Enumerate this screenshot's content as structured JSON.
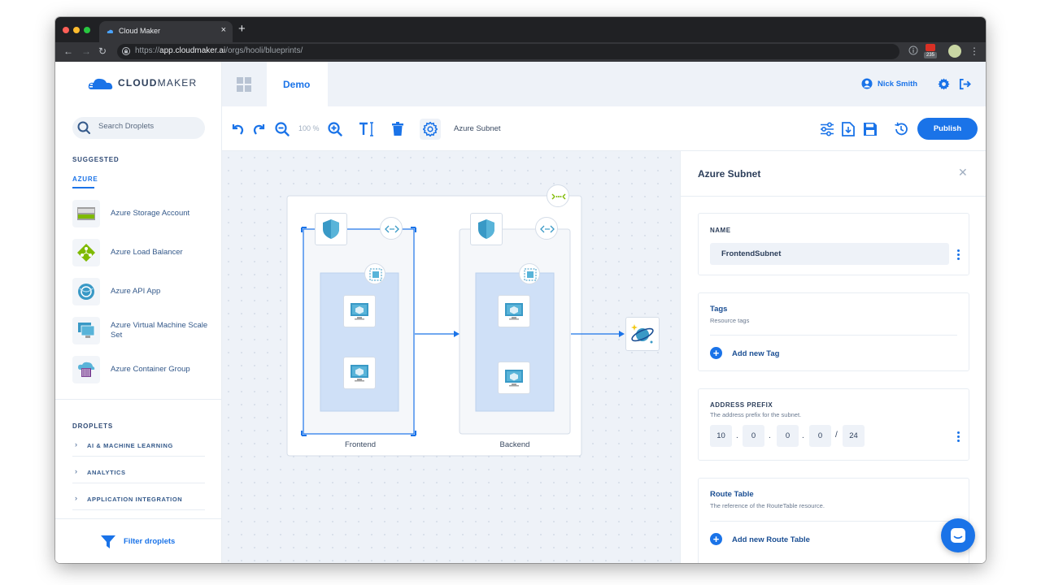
{
  "browser": {
    "tab_title": "Cloud Maker",
    "tab_close": "×",
    "new_tab": "+",
    "url_scheme": "https://",
    "url_host": "app.cloudmaker.ai",
    "url_path": "/orgs/hooli/blueprints/",
    "nav_back": "←",
    "nav_forward": "→",
    "nav_reload": "↻",
    "ext_badge": "235",
    "menu": "⋮"
  },
  "app": {
    "logo_bold": "CLOUD",
    "logo_rest": "MAKER"
  },
  "sidebar": {
    "search_placeholder": "Search Droplets",
    "suggested_label": "SUGGESTED",
    "azure_tab": "AZURE",
    "droplets": [
      {
        "label": "Azure Storage Account",
        "icon": "storage-account-icon"
      },
      {
        "label": "Azure Load Balancer",
        "icon": "load-balancer-icon"
      },
      {
        "label": "Azure API App",
        "icon": "api-app-icon"
      },
      {
        "label": "Azure Virtual Machine Scale Set",
        "icon": "vm-scale-set-icon"
      },
      {
        "label": "Azure Container Group",
        "icon": "container-group-icon"
      }
    ],
    "droplets_label": "DROPLETS",
    "categories": [
      {
        "label": "AI & MACHINE LEARNING",
        "chevron": "›"
      },
      {
        "label": "ANALYTICS",
        "chevron": "›"
      },
      {
        "label": "APPLICATION INTEGRATION",
        "chevron": "›"
      }
    ],
    "filter_label": "Filter droplets"
  },
  "header": {
    "tab_label": "Demo",
    "user_name": "Nick Smith"
  },
  "toolbar": {
    "zoom_value": "100 %",
    "selected_label": "Azure Subnet",
    "publish_label": "Publish"
  },
  "canvas": {
    "subnet_frontend_label": "Frontend",
    "subnet_backend_label": "Backend"
  },
  "panel": {
    "title": "Azure Subnet",
    "close": "✕",
    "name_caption": "NAME",
    "name_value": "FrontendSubnet",
    "tags_title": "Tags",
    "tags_sub": "Resource tags",
    "add_tag": "Add new Tag",
    "addr_caption": "ADDRESS PREFIX",
    "addr_sub": "The address prefix for the subnet.",
    "octets": [
      "10",
      "0",
      "0",
      "0"
    ],
    "dot": ".",
    "slash": "/",
    "prefix_len": "24",
    "route_title": "Route Table",
    "route_sub": "The reference of the RouteTable resource.",
    "add_route": "Add new Route Table",
    "plus": "+"
  },
  "colors": {
    "accent": "#1a73e8",
    "chrome_dark": "#202124",
    "canvas_bg": "#eef2f8",
    "subnet_fill": "#cfe0f7"
  }
}
